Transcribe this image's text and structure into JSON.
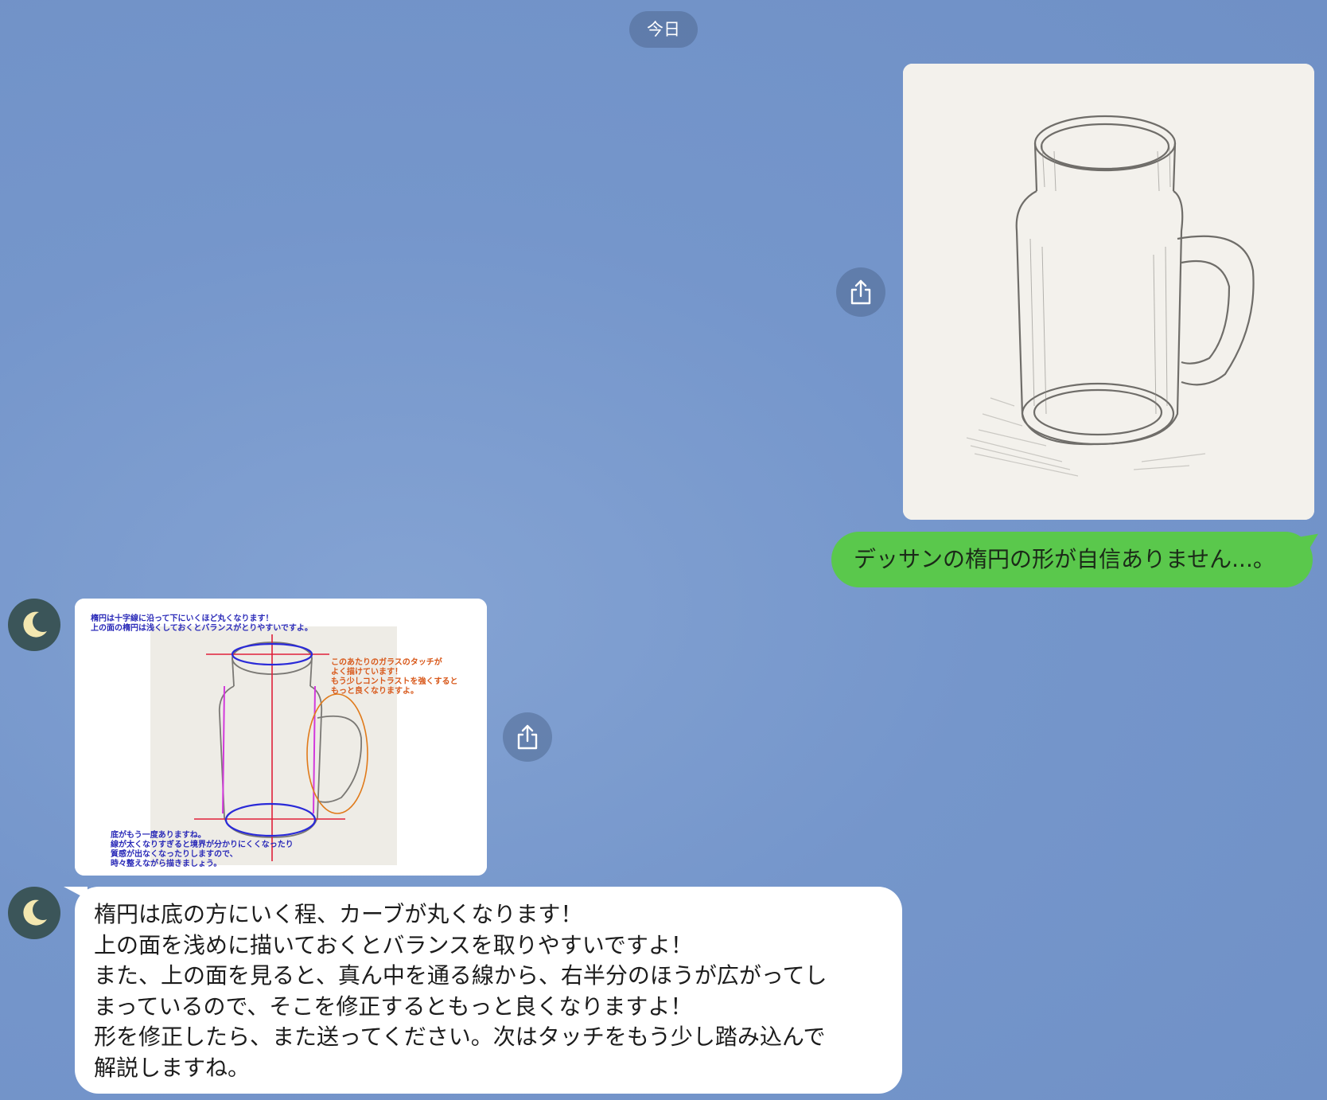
{
  "date_label": "今日",
  "icons": {
    "share": "share-icon",
    "avatar": "crescent-moon-icon"
  },
  "colors": {
    "outgoing_bubble": "#5ac84c",
    "incoming_bubble": "#ffffff",
    "background": "#7596cb",
    "avatar_bg": "#3b5559"
  },
  "messages": {
    "outgoing_text": "デッサンの楕円の形が自信ありません...。",
    "incoming_lines": [
      "楕円は底の方にいく程、カーブが丸くなります！",
      "上の面を浅めに描いておくとバランスを取りやすいですよ！",
      "また、上の面を見ると、真ん中を通る線から、右半分のほうが広がってし",
      "まっているので、そこを修正するともっと良くなりますよ！",
      "形を修正したら、また送ってください。次はタッチをもう少し踏み込んで",
      "解説しますね。"
    ]
  },
  "annotated_image": {
    "note_top": [
      "楕円は十字線に沿って下にいくほど丸くなります！",
      "上の面の楕円は浅くしておくとバランスがとりやすいですよ。"
    ],
    "note_right": [
      "このあたりのガラスのタッチが",
      "よく描けています！",
      "もう少しコントラストを強くすると",
      "もっと良くなりますよ。"
    ],
    "note_bottom": [
      "底がもう一度ありますね。",
      "線が太くなりすぎると境界が分かりにくくなったり",
      "質感が出なくなったりしますので、",
      "時々整えながら描きましょう。"
    ]
  }
}
